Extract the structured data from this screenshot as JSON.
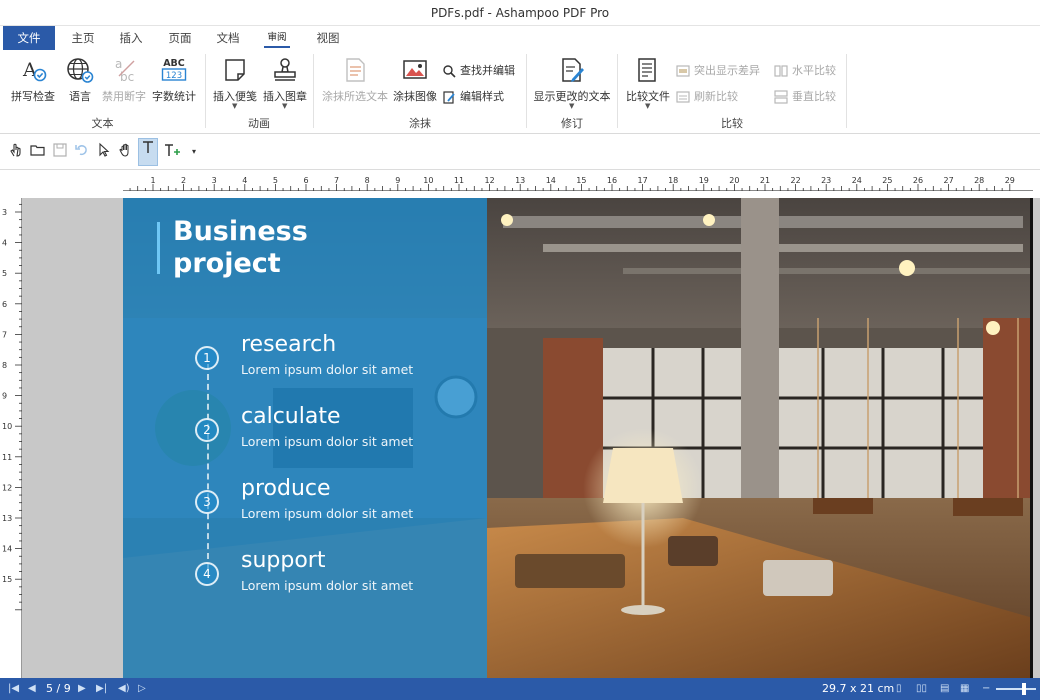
{
  "window": {
    "title": "PDFs.pdf - Ashampoo PDF Pro"
  },
  "tabs": [
    {
      "label": "文件"
    },
    {
      "label": "主页"
    },
    {
      "label": "插入"
    },
    {
      "label": "页面"
    },
    {
      "label": "文档"
    },
    {
      "label": "审阅"
    },
    {
      "label": "视图"
    }
  ],
  "ribbon": {
    "text_group": {
      "label": "文本",
      "spellcheck": "拼写检查",
      "language": "语言",
      "hyphenation": "禁用断字",
      "word_count": "字数统计",
      "word_count_icon_text": "ABC",
      "word_count_icon_num": "123"
    },
    "annotation_group": {
      "label": "动画",
      "insert_note": "插入便笺",
      "insert_stamp": "插入图章"
    },
    "redact_group": {
      "label": "涂抹",
      "redact_selected_text": "涂抹所选文本",
      "redact_image": "涂抹图像",
      "find_and_redact": "查找并编辑",
      "edit_style": "编辑样式"
    },
    "revise_group": {
      "label": "修订",
      "show_changed_text": "显示更改的文本"
    },
    "compare_group": {
      "label": "比较",
      "compare_files": "比较文件",
      "highlight_diff": "突出显示差异",
      "refresh_compare": "刷新比较",
      "horizontal_compare": "水平比较",
      "vertical_compare": "垂直比较"
    }
  },
  "ruler": {
    "horizontal_ticks": [
      "1",
      "2",
      "3",
      "4",
      "5",
      "6",
      "7",
      "8",
      "9",
      "10",
      "11",
      "12",
      "13",
      "14",
      "15",
      "16",
      "17",
      "18",
      "19",
      "20",
      "21",
      "22",
      "23",
      "24",
      "25",
      "26",
      "27",
      "28",
      "29"
    ],
    "vertical_ticks": [
      "3",
      "4",
      "5",
      "6",
      "7",
      "8",
      "9",
      "10",
      "11",
      "12",
      "13",
      "14",
      "15"
    ]
  },
  "document": {
    "heading_line1": "Business",
    "heading_line2": "project",
    "steps": [
      {
        "num": "1",
        "title": "research",
        "subtitle": "Lorem ipsum dolor sit amet"
      },
      {
        "num": "2",
        "title": "calculate",
        "subtitle": "Lorem ipsum dolor sit amet"
      },
      {
        "num": "3",
        "title": "produce",
        "subtitle": "Lorem ipsum dolor sit amet"
      },
      {
        "num": "4",
        "title": "support",
        "subtitle": "Lorem ipsum dolor sit amet"
      }
    ]
  },
  "status": {
    "page_indicator": "5 / 9",
    "page_size": "29.7 x 21 cm"
  },
  "colors": {
    "accent": "#2b5aa8",
    "panel_blue": "#1f8ccd"
  }
}
